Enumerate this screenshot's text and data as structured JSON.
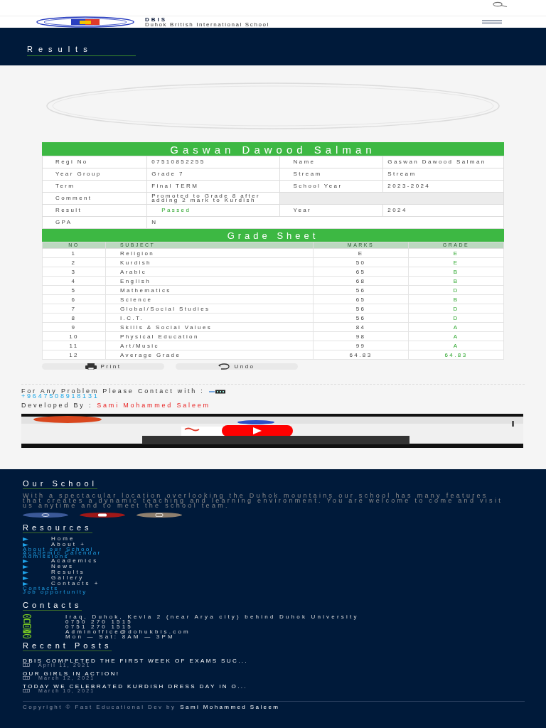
{
  "header": {
    "brand": "DBIS",
    "subtitle": "Duhok British International School"
  },
  "banner": {
    "title": "Results"
  },
  "student": {
    "name": "Gaswan Dawood Salman",
    "rows": [
      {
        "cells": [
          {
            "label": "Regi No",
            "value": "07510852255",
            "kind": "text"
          },
          {
            "label": "Name",
            "value": "Gaswan Dawood Salman",
            "kind": "text"
          }
        ]
      },
      {
        "cells": [
          {
            "label": "Year Group",
            "value": "Grade 7",
            "kind": "text"
          },
          {
            "label": "Stream",
            "value": "Stream",
            "kind": "text"
          }
        ]
      },
      {
        "cells": [
          {
            "label": "Term",
            "value": "Final TERM",
            "kind": "text"
          },
          {
            "label": "School Year",
            "value": "2023-2024",
            "kind": "text"
          }
        ]
      },
      {
        "cells": [
          {
            "label": "Comment",
            "value": "Promoted to Grade 8 after adding 2 mark to Kurdish",
            "kind": "text"
          }
        ]
      },
      {
        "cells": [
          {
            "label": "Result",
            "value": "Passed",
            "kind": "result"
          },
          {
            "label": "Year",
            "value": "2024",
            "kind": "text"
          }
        ]
      },
      {
        "cells": [
          {
            "label": "GPA",
            "value": "N",
            "kind": "text"
          }
        ]
      }
    ]
  },
  "grade_sheet": {
    "title": "Grade Sheet",
    "columns": [
      "NO",
      "SUBJECT",
      "MARKS",
      "GRADE"
    ],
    "rows": [
      [
        "1",
        "Religion",
        "E",
        "E"
      ],
      [
        "2",
        "Kurdish",
        "50",
        "E"
      ],
      [
        "3",
        "Arabic",
        "65",
        "B"
      ],
      [
        "4",
        "English",
        "68",
        "B"
      ],
      [
        "5",
        "Mathematics",
        "56",
        "D"
      ],
      [
        "6",
        "Science",
        "65",
        "B"
      ],
      [
        "7",
        "Global/Social Studies",
        "56",
        "D"
      ],
      [
        "8",
        "I.C.T.",
        "56",
        "D"
      ],
      [
        "9",
        "Skills & Social Values",
        "84",
        "A"
      ],
      [
        "10",
        "Physical Education",
        "98",
        "A"
      ],
      [
        "11",
        "Art/Music",
        "99",
        "A"
      ],
      [
        "12",
        "Average Grade",
        "64.83",
        "64.83"
      ]
    ]
  },
  "buttons": [
    "Print",
    "Undo"
  ],
  "contact": {
    "text": "For Any Problem Please Contact with :",
    "phone": "+9647508918131",
    "developed_label": "Developed By :",
    "developer": "Sami Mohammed Saleem"
  },
  "video": {
    "kind": "picture"
  },
  "footer": {
    "about": {
      "title": "Our School",
      "text": "With a spectacular location overlooking the Duhok mountains our school has many features that creates a dynamic teaching and learning environment. You are welcome to come and visit us anytime and to meet the school team."
    },
    "resources": {
      "title": "Resources",
      "items": [
        {
          "label": "Home"
        },
        {
          "label": "About +",
          "children": [
            {
              "label": "About our School"
            },
            {
              "label": "Academic Calendar"
            },
            {
              "label": "Admissions"
            }
          ]
        },
        {
          "label": "Academics"
        },
        {
          "label": "News"
        },
        {
          "label": "Results"
        },
        {
          "label": "Gallery"
        },
        {
          "label": "Contacts +",
          "children": [
            {
              "label": "Contacts"
            },
            {
              "label": "Job opportunity"
            }
          ]
        }
      ]
    },
    "contacts": {
      "title": "Contacts",
      "items": [
        {
          "kind": "address",
          "text": "Iraq, Duhok, Kevla 2 (near Arya city) behind Duhok University"
        },
        {
          "kind": "mobile",
          "text": "0750 270 1515"
        },
        {
          "kind": "phone",
          "text": "0751 270 1515"
        },
        {
          "kind": "email",
          "text": "Adminoffice@dohukbis.com"
        },
        {
          "kind": "hours",
          "text": "Mon — Sat: 8AM — 3PM"
        }
      ]
    },
    "recent_posts": {
      "title": "Recent Posts",
      "items": [
        {
          "title": "DBIS COMPLETED THE FIRST WEEK OF EXAMS SUC...",
          "date": "April 11, 2021"
        },
        {
          "title": "OUR GIRLS IN ACTION!",
          "date": "March 12, 2021"
        },
        {
          "title": "TODAY WE CELEBRATED KURDISH DRESS DAY IN O...",
          "date": "March 10, 2021"
        }
      ]
    },
    "copyright": {
      "text": "Copyright © Fast Educational Dev by",
      "author": "Sami Mohammed Saleem"
    }
  }
}
